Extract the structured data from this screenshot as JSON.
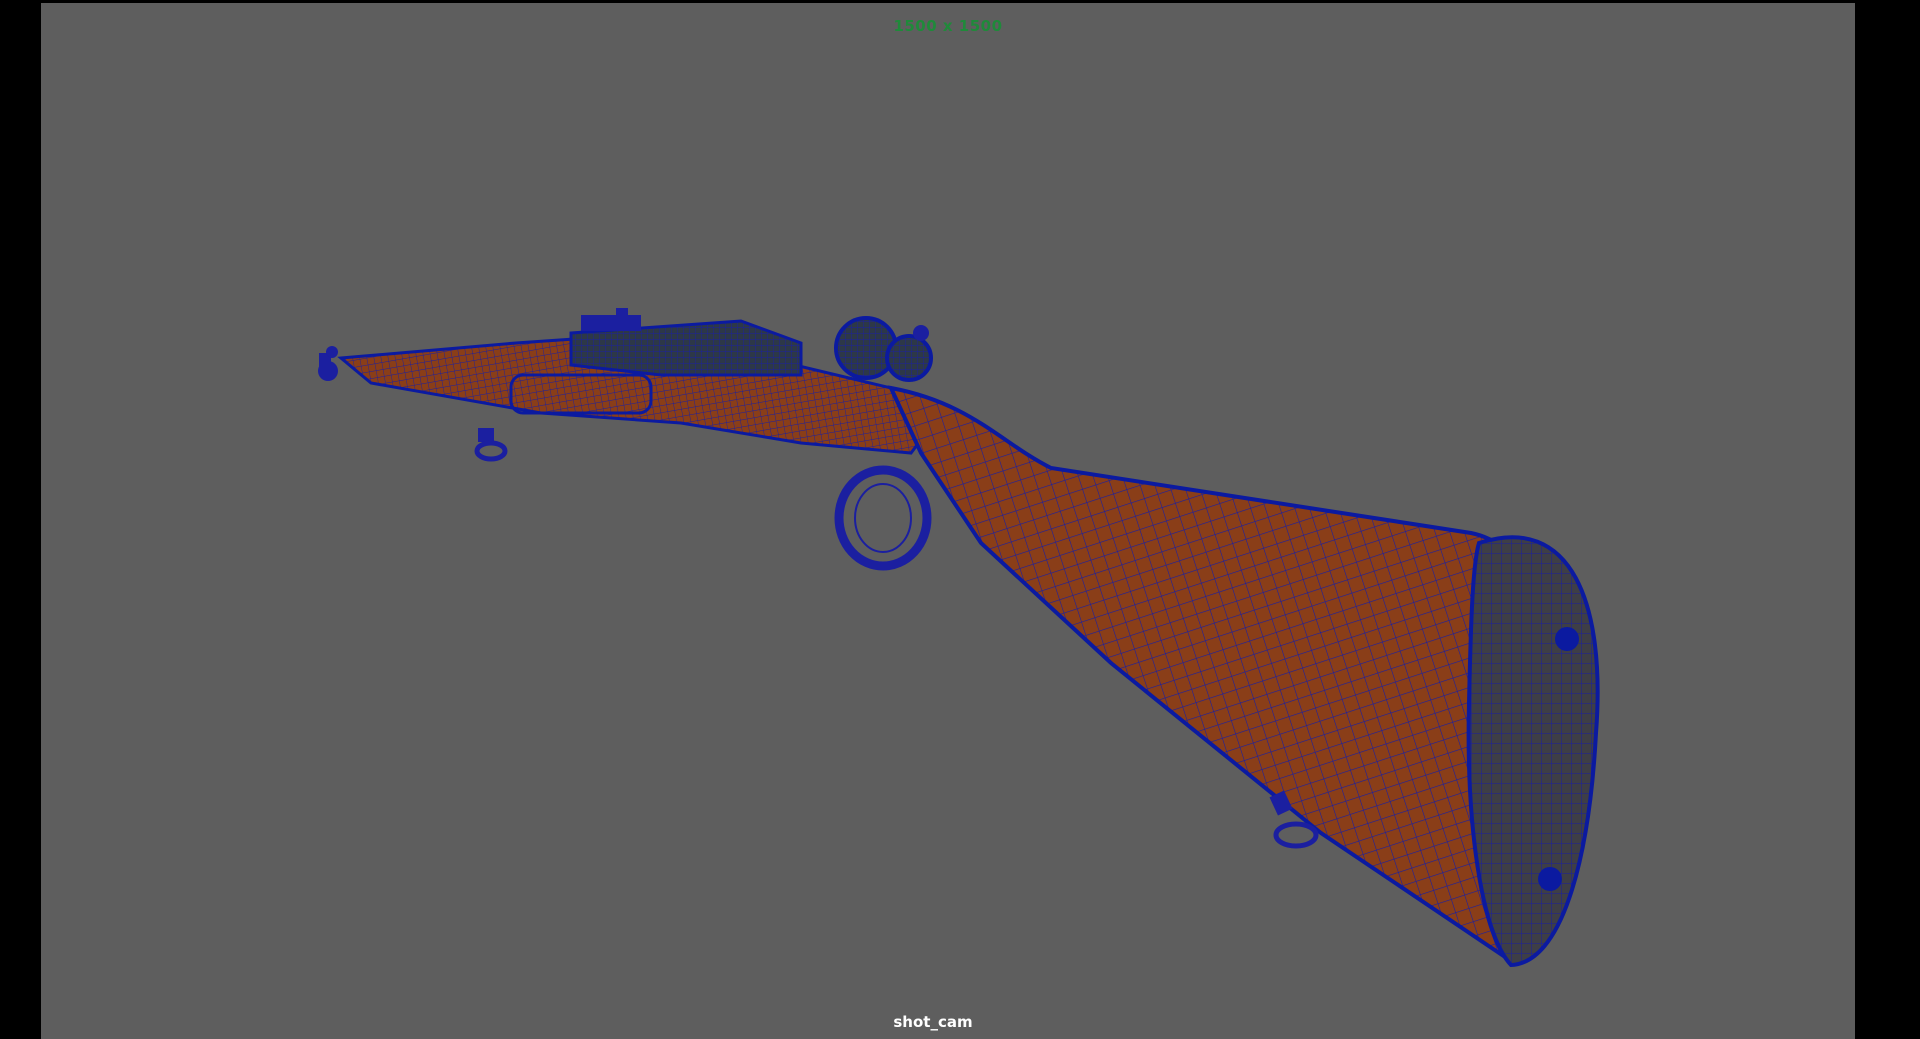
{
  "viewport": {
    "resolution_gate_label": "1500 x 1500",
    "camera_name": "shot_cam",
    "background_color": "#5e5e5e",
    "wireframe_color": "#0b1aa0",
    "wood_color": "#8a3e18",
    "buttpad_color": "#3e3e46",
    "resolution_label_color": "#1f8a3a"
  },
  "scene": {
    "object": "rifle-wireframe-on-shaded-model",
    "icon": "rifle-model"
  }
}
